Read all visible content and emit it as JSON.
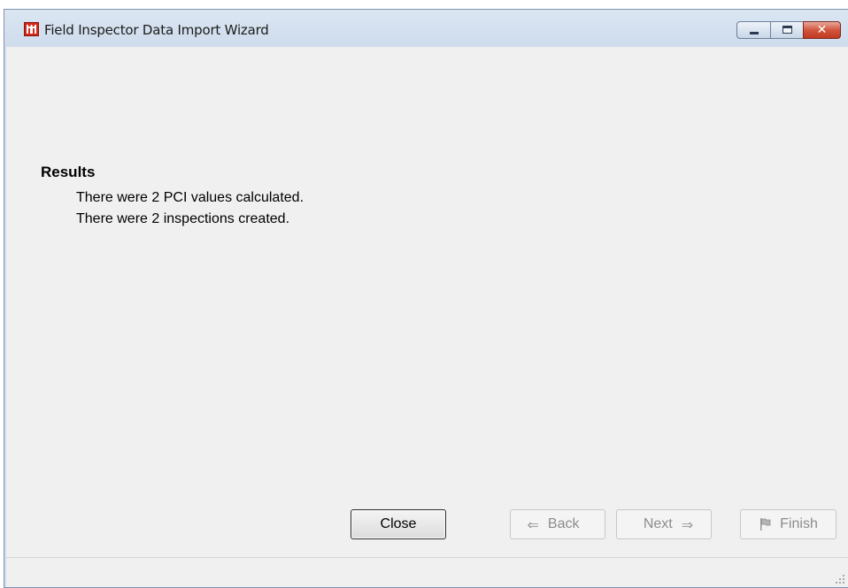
{
  "window": {
    "title": "Field Inspector Data Import Wizard",
    "app_icon": "castle-icon",
    "controls": [
      "minimize-icon",
      "maximize-icon",
      "close-icon"
    ],
    "close_glyph": "✕"
  },
  "results": {
    "heading": "Results",
    "lines": [
      "There were 2 PCI values calculated.",
      "There were 2 inspections created."
    ]
  },
  "buttons": {
    "close": "Close",
    "back": "Back",
    "next": "Next",
    "finish": "Finish",
    "back_arrow": "⇐",
    "next_arrow": "⇒"
  },
  "colors": {
    "title_bar": "#cfdcec",
    "client_bg": "#f0f0f0",
    "close_button_red": "#c0391f",
    "app_icon_red": "#d42a1a"
  }
}
